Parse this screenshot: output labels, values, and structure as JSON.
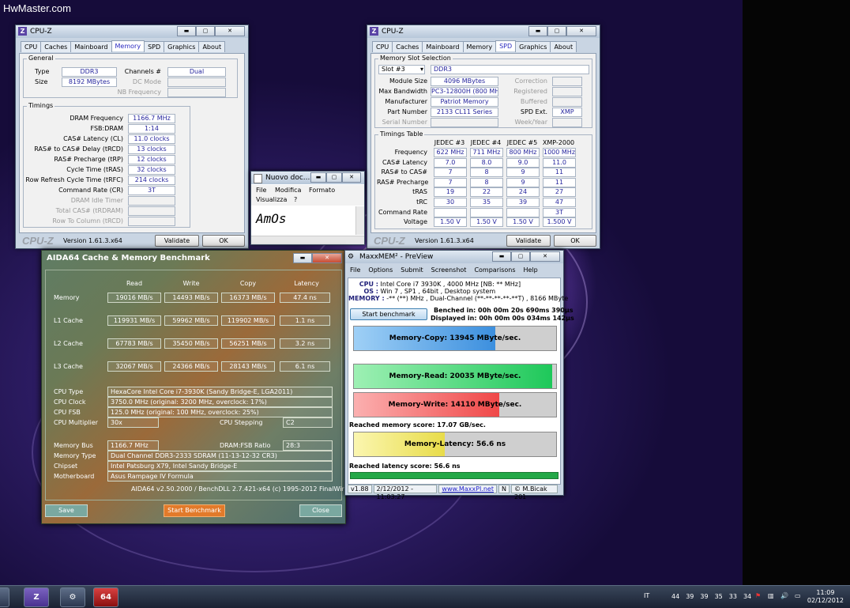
{
  "watermark": "HwMaster.com",
  "cpuz_memory": {
    "title": "CPU-Z",
    "tabs": [
      "CPU",
      "Caches",
      "Mainboard",
      "Memory",
      "SPD",
      "Graphics",
      "About"
    ],
    "active_tab": "Memory",
    "general_label": "General",
    "type_label": "Type",
    "type_value": "DDR3",
    "size_label": "Size",
    "size_value": "8192 MBytes",
    "channels_label": "Channels #",
    "channels_value": "Dual",
    "dcmode_label": "DC Mode",
    "nbfreq_label": "NB Frequency",
    "timings_label": "Timings",
    "timings": [
      {
        "label": "DRAM Frequency",
        "value": "1166.7 MHz"
      },
      {
        "label": "FSB:DRAM",
        "value": "1:14"
      },
      {
        "label": "CAS# Latency (CL)",
        "value": "11.0 clocks"
      },
      {
        "label": "RAS# to CAS# Delay (tRCD)",
        "value": "13 clocks"
      },
      {
        "label": "RAS# Precharge (tRP)",
        "value": "12 clocks"
      },
      {
        "label": "Cycle Time (tRAS)",
        "value": "32 clocks"
      },
      {
        "label": "Row Refresh Cycle Time (tRFC)",
        "value": "214 clocks"
      },
      {
        "label": "Command Rate (CR)",
        "value": "3T"
      },
      {
        "label": "DRAM Idle Timer",
        "value": ""
      },
      {
        "label": "Total CAS# (tRDRAM)",
        "value": ""
      },
      {
        "label": "Row To Column (tRCD)",
        "value": ""
      }
    ],
    "logo": "CPU-Z",
    "version": "Version 1.61.3.x64",
    "validate": "Validate",
    "ok": "OK"
  },
  "cpuz_spd": {
    "title": "CPU-Z",
    "tabs": [
      "CPU",
      "Caches",
      "Mainboard",
      "Memory",
      "SPD",
      "Graphics",
      "About"
    ],
    "active_tab": "SPD",
    "slot_group": "Memory Slot Selection",
    "slot": "Slot #3",
    "slot_type": "DDR3",
    "module_size_label": "Module Size",
    "module_size": "4096 MBytes",
    "max_bw_label": "Max Bandwidth",
    "max_bw": "PC3-12800H (800 MHz)",
    "manufacturer_label": "Manufacturer",
    "manufacturer": "Patriot Memory",
    "part_label": "Part Number",
    "part": "2133 CL11 Series",
    "serial_label": "Serial Number",
    "correction_label": "Correction",
    "registered_label": "Registered",
    "buffered_label": "Buffered",
    "spdext_label": "SPD Ext.",
    "spdext": "XMP",
    "weekyear_label": "Week/Year",
    "timings_group": "Timings Table",
    "cols": [
      "JEDEC #3",
      "JEDEC #4",
      "JEDEC #5",
      "XMP-2000"
    ],
    "rows": [
      {
        "label": "Frequency",
        "values": [
          "622 MHz",
          "711 MHz",
          "800 MHz",
          "1000 MHz"
        ]
      },
      {
        "label": "CAS# Latency",
        "values": [
          "7.0",
          "8.0",
          "9.0",
          "11.0"
        ]
      },
      {
        "label": "RAS# to CAS#",
        "values": [
          "7",
          "8",
          "9",
          "11"
        ]
      },
      {
        "label": "RAS# Precharge",
        "values": [
          "7",
          "8",
          "9",
          "11"
        ]
      },
      {
        "label": "tRAS",
        "values": [
          "19",
          "22",
          "24",
          "27"
        ]
      },
      {
        "label": "tRC",
        "values": [
          "30",
          "35",
          "39",
          "47"
        ]
      },
      {
        "label": "Command Rate",
        "values": [
          "",
          "",
          "",
          "3T"
        ]
      },
      {
        "label": "Voltage",
        "values": [
          "1.50 V",
          "1.50 V",
          "1.50 V",
          "1.500 V"
        ]
      }
    ],
    "logo": "CPU-Z",
    "version": "Version 1.61.3.x64",
    "validate": "Validate",
    "ok": "OK"
  },
  "notepad": {
    "title": "Nuovo doc...",
    "menu": [
      "File",
      "Modifica",
      "Formato",
      "Visualizza",
      "?"
    ],
    "text": "AmOs"
  },
  "aida": {
    "title": "AIDA64 Cache & Memory Benchmark",
    "headers": [
      "Read",
      "Write",
      "Copy",
      "Latency"
    ],
    "rows": [
      {
        "label": "Memory",
        "values": [
          "19016 MB/s",
          "14493 MB/s",
          "16373 MB/s",
          "47.4 ns"
        ]
      },
      {
        "label": "L1 Cache",
        "values": [
          "119931 MB/s",
          "59962 MB/s",
          "119902 MB/s",
          "1.1 ns"
        ]
      },
      {
        "label": "L2 Cache",
        "values": [
          "67783 MB/s",
          "35450 MB/s",
          "56251 MB/s",
          "3.2 ns"
        ]
      },
      {
        "label": "L3 Cache",
        "values": [
          "32067 MB/s",
          "24366 MB/s",
          "28143 MB/s",
          "6.1 ns"
        ]
      }
    ],
    "cpu_type_label": "CPU Type",
    "cpu_type": "HexaCore Intel Core i7-3930K  (Sandy Bridge-E, LGA2011)",
    "cpu_clock_label": "CPU Clock",
    "cpu_clock": "3750.0 MHz  (original: 3200 MHz, overclock: 17%)",
    "cpu_fsb_label": "CPU FSB",
    "cpu_fsb": "125.0 MHz  (original: 100 MHz, overclock: 25%)",
    "cpu_mult_label": "CPU Multiplier",
    "cpu_mult": "30x",
    "cpu_step_label": "CPU Stepping",
    "cpu_step": "C2",
    "mem_bus_label": "Memory Bus",
    "mem_bus": "1166.7 MHz",
    "dram_fsb_label": "DRAM:FSB Ratio",
    "dram_fsb": "28:3",
    "mem_type_label": "Memory Type",
    "mem_type": "Dual Channel DDR3-2333 SDRAM  (11-13-12-32 CR3)",
    "chipset_label": "Chipset",
    "chipset": "Intel Patsburg X79, Intel Sandy Bridge-E",
    "mobo_label": "Motherboard",
    "mobo": "Asus Rampage IV Formula",
    "footer": "AIDA64 v2.50.2000 / BenchDLL 2.7.421-x64  (c) 1995-2012 FinalWire Ltd.",
    "save": "Save",
    "start": "Start Benchmark",
    "close": "Close"
  },
  "maxx": {
    "title": "MaxxMEM² - PreView",
    "menu": [
      "File",
      "Options",
      "Submit",
      "Screenshot",
      "Comparisons",
      "Help"
    ],
    "cpu_label": "CPU :",
    "cpu": "Intel Core i7 3930K , 4000 MHz  [NB: ** MHz]",
    "os_label": "OS :",
    "os": "Win 7 , SP1 , 64bit , Desktop system",
    "memory_label": "MEMORY :",
    "memory": "-** (**) MHz , Dual-Channel (**-**-**-**-**T) , 8166 MByte",
    "start": "Start benchmark",
    "benched": "Benched in: 00h 00m 20s 690ms 390µs",
    "displayed": "Displayed in: 00h 00m 00s 034ms 142µs",
    "copy": "Memory-Copy: 13945 MByte/sec.",
    "read": "Memory-Read: 20035 MByte/sec.",
    "write": "Memory-Write: 14110 MByte/sec.",
    "score": "Reached memory score: 17.07 GB/sec.",
    "latency": "Memory-Latency: 56.6 ns",
    "lat_score": "Reached latency score: 56.6 ns",
    "status": [
      "v1.88",
      "2/12/2012 - 11:03:27",
      "www.MaxxPI.net",
      "N",
      "© M.Bicak 201"
    ],
    "copy_fill": 0.7,
    "read_fill": 0.98,
    "write_fill": 0.72,
    "lat_fill": 0.45
  },
  "taskbar": {
    "icons": [
      "cpuz-icon",
      "gears-icon",
      "aida64-icon"
    ],
    "aida_label": "64",
    "lang": "IT",
    "temps": [
      "44",
      "39",
      "39",
      "35",
      "33",
      "34"
    ],
    "time": "11:09",
    "date": "02/12/2012"
  }
}
